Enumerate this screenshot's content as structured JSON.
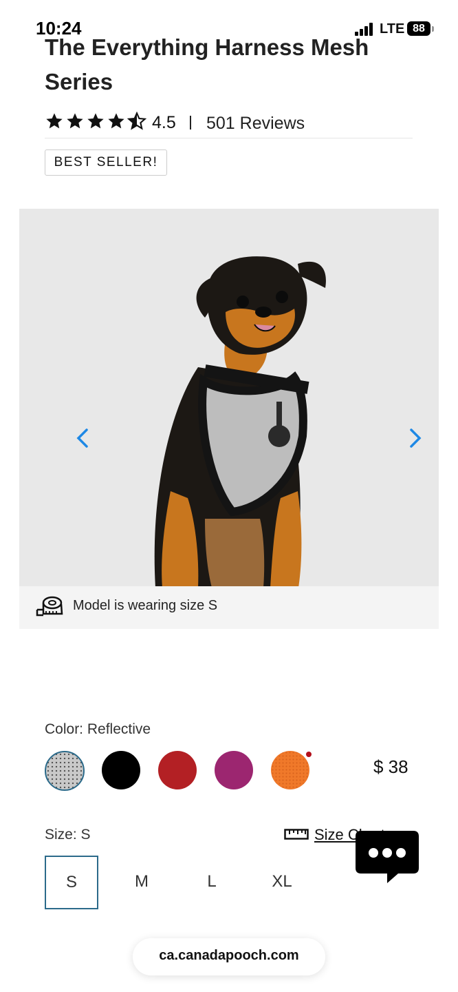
{
  "status_bar": {
    "time": "10:24",
    "carrier": "LTE",
    "battery": "88"
  },
  "product": {
    "title": "The Everything Harness Mesh Series",
    "rating": "4.5",
    "rating_stars": 4.5,
    "reviews_label": "501 Reviews",
    "badge": "BEST SELLER!",
    "image_caption": "Model is wearing size S",
    "color_label": "Color: Reflective",
    "price": "$ 38",
    "size_label": "Size: S",
    "size_chart_label": "Size Chart",
    "colors": [
      {
        "name": "Reflective",
        "hex": "#c9c9c9",
        "selected": true
      },
      {
        "name": "Black",
        "hex": "#000000",
        "selected": false
      },
      {
        "name": "Red",
        "hex": "#b32024",
        "selected": false
      },
      {
        "name": "Plum",
        "hex": "#9c2670",
        "selected": false
      },
      {
        "name": "Orange",
        "hex": "#f0792a",
        "selected": false
      }
    ],
    "sizes": [
      "S",
      "M",
      "L",
      "XL"
    ],
    "selected_size": "S"
  },
  "icons": {
    "gallery_prev": "chevron-left-icon",
    "gallery_next": "chevron-right-icon",
    "caption": "tape-measure-icon",
    "size_chart": "ruler-icon",
    "chat": "chat-bubble-icon"
  },
  "colors": {
    "accent": "#1e88e5",
    "selected_border": "#2b6a8a",
    "gallery_bg": "#e8e8e8"
  },
  "browser": {
    "url": "ca.canadapooch.com"
  }
}
